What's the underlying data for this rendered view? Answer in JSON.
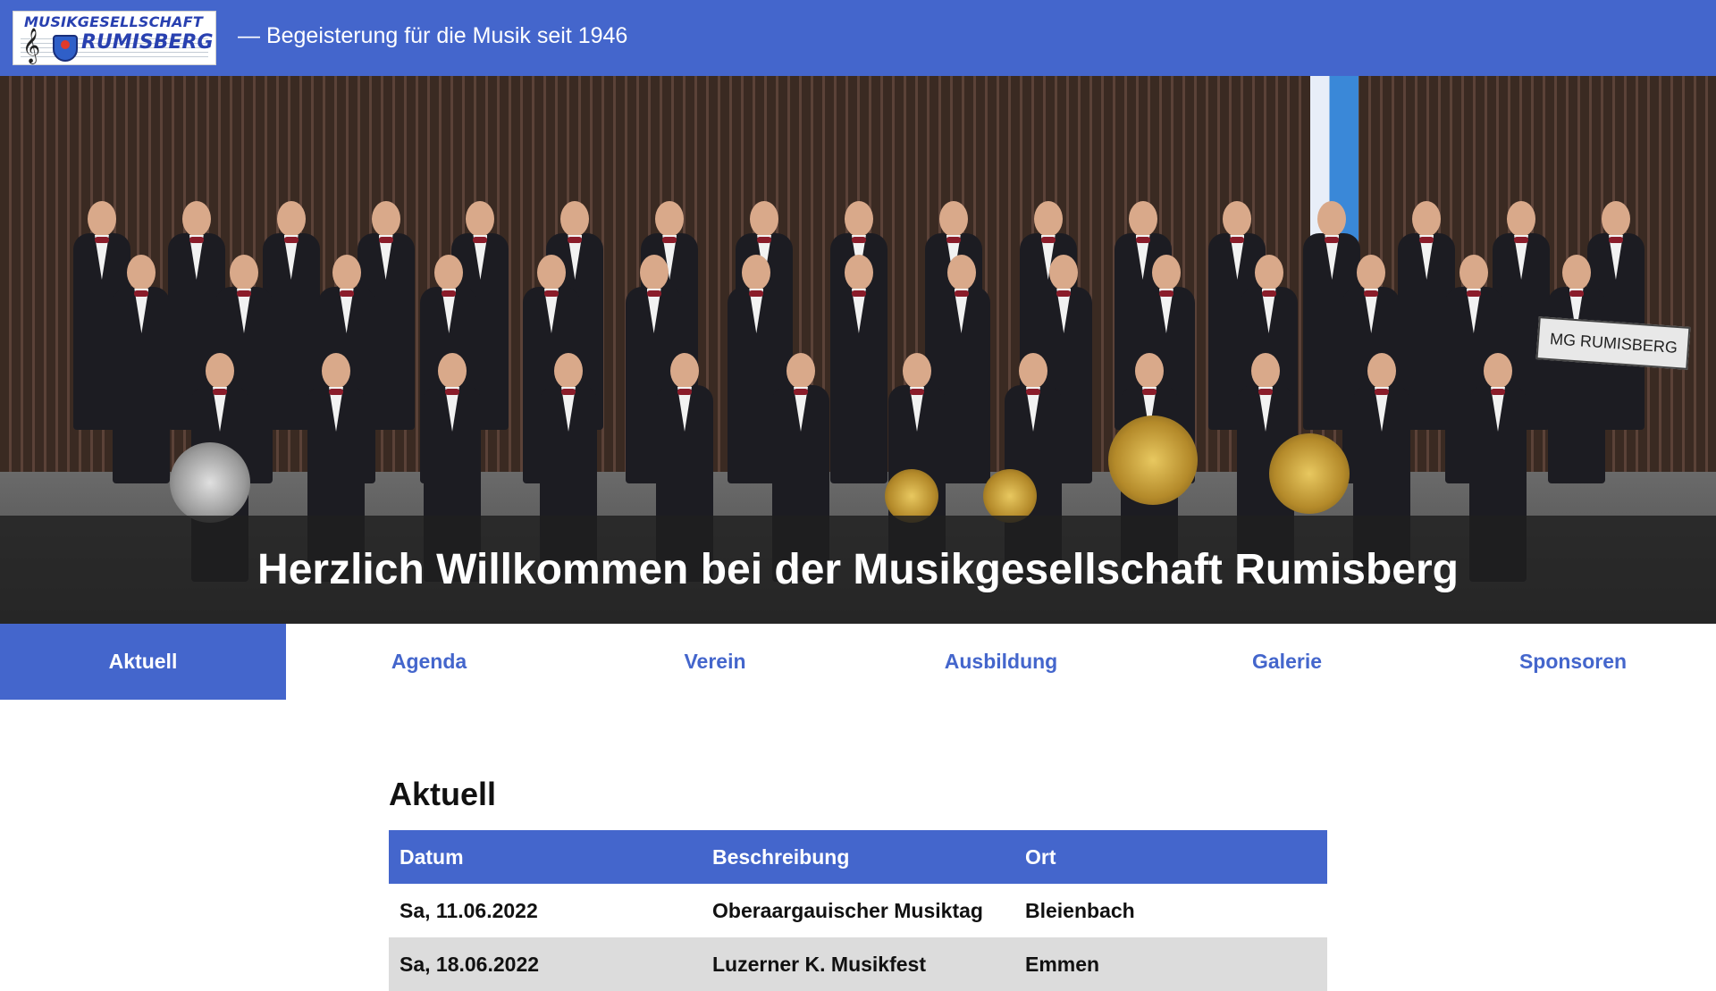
{
  "header": {
    "logo_line1": "MUSIKGESELLSCHAFT",
    "logo_line2": "RUMISBERG",
    "tagline": "—  Begeisterung für die Musik seit 1946",
    "brand_color": "#4466cc"
  },
  "hero": {
    "title": "Herzlich Willkommen bei der Musikgesellschaft Rumisberg",
    "banner_text": "MG RUMISBERG"
  },
  "nav": {
    "items": [
      {
        "label": "Aktuell",
        "active": true
      },
      {
        "label": "Agenda",
        "active": false
      },
      {
        "label": "Verein",
        "active": false
      },
      {
        "label": "Ausbildung",
        "active": false
      },
      {
        "label": "Galerie",
        "active": false
      },
      {
        "label": "Sponsoren",
        "active": false
      }
    ]
  },
  "main": {
    "section_title": "Aktuell",
    "table": {
      "headers": [
        "Datum",
        "Beschreibung",
        "Ort"
      ],
      "rows": [
        [
          "Sa, 11.06.2022",
          "Oberaargauischer Musiktag",
          "Bleienbach"
        ],
        [
          "Sa, 18.06.2022",
          "Luzerner K. Musikfest",
          "Emmen"
        ]
      ]
    }
  }
}
